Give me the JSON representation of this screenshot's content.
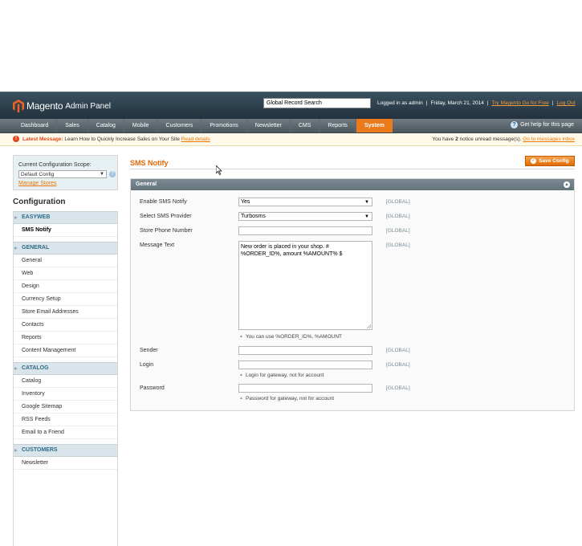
{
  "header": {
    "logo_text": "Magento",
    "logo_sub": "Admin Panel",
    "search_value": "Global Record Search",
    "logged_in": "Logged in as admin",
    "date": "Friday, March 21, 2014",
    "try_link": "Try Magento Go for Free",
    "logout": "Log Out"
  },
  "nav": {
    "items": [
      "Dashboard",
      "Sales",
      "Catalog",
      "Mobile",
      "Customers",
      "Promotions",
      "Newsletter",
      "CMS",
      "Reports",
      "System"
    ],
    "active": "System",
    "help": "Get help for this page"
  },
  "message": {
    "label": "Latest Message:",
    "text": "Learn How to Quickly Increase Sales on Your Site",
    "link": "Read details",
    "right_prefix": "You have",
    "right_count": "2",
    "right_suffix": "notice unread message(s).",
    "right_link": "Go to messages inbox"
  },
  "scope": {
    "label": "Current Configuration Scope:",
    "selected": "Default Config",
    "manage": "Manage Stores"
  },
  "sidebar": {
    "title": "Configuration",
    "sections": [
      {
        "head": "EASYWEB",
        "items": [
          "SMS Notify"
        ]
      },
      {
        "head": "GENERAL",
        "items": [
          "General",
          "Web",
          "Design",
          "Currency Setup",
          "Store Email Addresses",
          "Contacts",
          "Reports",
          "Content Management"
        ]
      },
      {
        "head": "CATALOG",
        "items": [
          "Catalog",
          "Inventory",
          "Google Sitemap",
          "RSS Feeds",
          "Email to a Friend"
        ]
      },
      {
        "head": "CUSTOMERS",
        "items": [
          "Newsletter"
        ]
      }
    ],
    "selected": "SMS Notify"
  },
  "main": {
    "title": "SMS Notify",
    "save_label": "Save Config",
    "fieldset_title": "General",
    "fields": {
      "enable_label": "Enable SMS Notify",
      "enable_value": "Yes",
      "provider_label": "Select SMS Provider",
      "provider_value": "Turbosms",
      "phone_label": "Store Phone Number",
      "phone_value": "",
      "message_label": "Message Text",
      "message_value": "New order is placed in your shop. # %ORDER_ID%, amount %AMOUNT% $",
      "message_hint": "You can use %ORDER_ID%, %AMOUNT",
      "sender_label": "Sender",
      "sender_value": "",
      "login_label": "Login",
      "login_value": "",
      "login_hint": "Login for gateway, not for account",
      "password_label": "Password",
      "password_value": "",
      "password_hint": "Password for gateway, not for account",
      "scope_tag": "[GLOBAL]"
    }
  },
  "colors": {
    "accent": "#ea7a1b",
    "header_bg": "#22313b",
    "section_text": "#2e6b8a",
    "title": "#e26703"
  }
}
